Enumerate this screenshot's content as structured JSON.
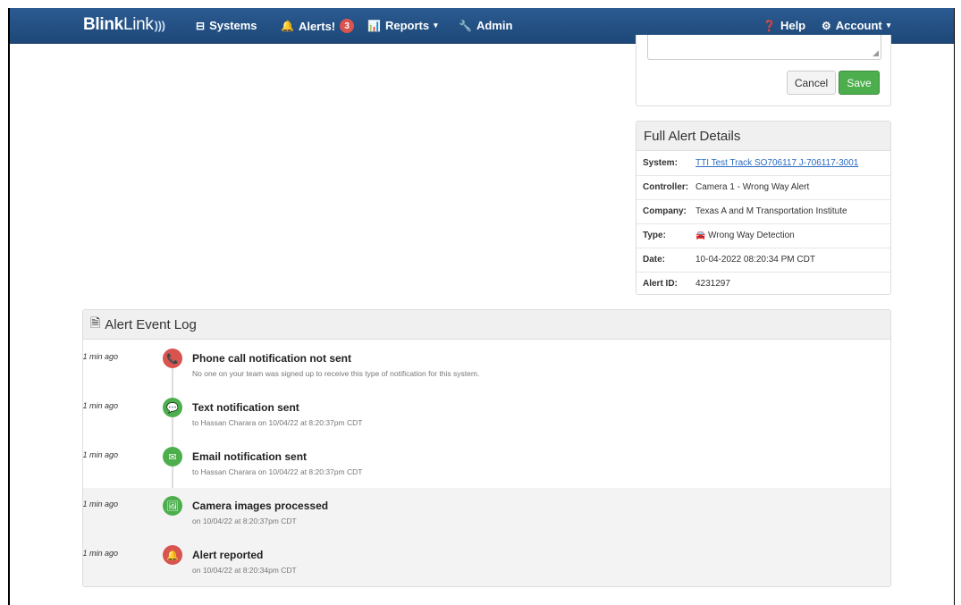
{
  "navbar": {
    "brand_bold": "Blink",
    "brand_light": "Link",
    "brand_waves": ")))",
    "items": [
      {
        "label": "Systems",
        "icon": "⊟"
      },
      {
        "label": "Alerts!",
        "icon": "🔔",
        "badge": "3"
      },
      {
        "label": "Reports",
        "icon": "📊",
        "caret": "▾"
      },
      {
        "label": "Admin",
        "icon": "🔧"
      }
    ],
    "right_items": [
      {
        "label": "Help",
        "icon": "❓"
      },
      {
        "label": "Account",
        "icon": "⚙",
        "caret": "▾"
      }
    ]
  },
  "comment_box": {
    "value": "",
    "resize_glyph": "◢",
    "cancel_label": "Cancel",
    "save_label": "Save"
  },
  "details": {
    "title": "Full Alert Details",
    "rows": [
      {
        "key": "System:",
        "value": "TTI Test Track SO706117 J-706117-3001",
        "link": true
      },
      {
        "key": "Controller:",
        "value": "Camera 1 - Wrong Way Alert"
      },
      {
        "key": "Company:",
        "value": "Texas A and M Transportation Institute"
      },
      {
        "key": "Type:",
        "value": "Wrong Way Detection",
        "icon": "🚘"
      },
      {
        "key": "Date:",
        "value": "10-04-2022 08:20:34 PM CDT"
      },
      {
        "key": "Alert ID:",
        "value": "4231297"
      }
    ]
  },
  "event_log": {
    "title": "Alert Event Log",
    "title_icon": "🗎",
    "entries": [
      {
        "time": "1 min ago",
        "title": "Phone call notification not sent",
        "sub": "No one on your team was signed up to receive this type of notification for this system.",
        "status": "red",
        "icon": "📞"
      },
      {
        "time": "1 min ago",
        "title": "Text notification sent",
        "sub": "to Hassan Charara on 10/04/22 at 8:20:37pm CDT",
        "status": "green",
        "icon": "💬"
      },
      {
        "time": "1 min ago",
        "title": "Email notification sent",
        "sub": "to Hassan Charara on 10/04/22 at 8:20:37pm CDT",
        "status": "green",
        "icon": "✉"
      },
      {
        "time": "1 min ago",
        "title": "Camera images processed",
        "sub": "on 10/04/22 at 8:20:37pm CDT",
        "status": "green",
        "icon": "🖼"
      },
      {
        "time": "1 min ago",
        "title": "Alert reported",
        "sub": "on 10/04/22 at 8:20:34pm CDT",
        "status": "red",
        "icon": "🔔"
      }
    ]
  },
  "colors": {
    "navbar": "#2b5b91",
    "danger": "#d9534f",
    "success": "#4cae4c",
    "link": "#2a6bc2"
  }
}
